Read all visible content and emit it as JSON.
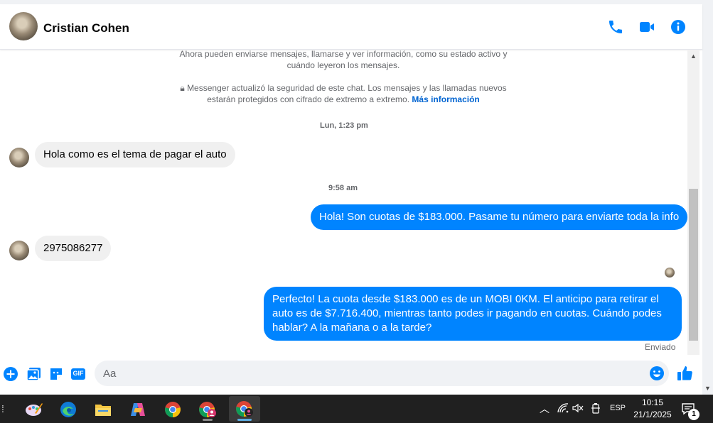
{
  "header": {
    "contact_name": "Cristian Cohen",
    "icons": [
      "phone-icon",
      "video-icon",
      "info-icon"
    ]
  },
  "chat": {
    "system_info_1": "Ahora pueden enviarse mensajes, llamarse y ver información, como su estado activo y cuándo leyeron los mensajes.",
    "system_info_2": "Messenger actualizó la seguridad de este chat. Los mensajes y las llamadas nuevos estarán protegidos con cifrado de extremo a extremo.",
    "system_info_link": "Más información",
    "timestamp_1": "Lun, 1:23 pm",
    "timestamp_2": "9:58 am",
    "messages": [
      {
        "from": "contact",
        "text": "Hola como es el tema de pagar el auto"
      },
      {
        "from": "me",
        "text": "Hola! Son cuotas de $183.000. Pasame tu número para enviarte toda la info"
      },
      {
        "from": "contact",
        "text": "2975086277"
      },
      {
        "from": "me",
        "text": "Perfecto! La cuota desde $183.000 es de un MOBI 0KM. El anticipo para retirar el auto es de $7.716.400, mientras tanto podes ir pagando en cuotas. Cuándo podes hablar? A la mañana o a la tarde?"
      }
    ],
    "status": "Enviado"
  },
  "composer": {
    "placeholder": "Aa",
    "gif_label": "GIF"
  },
  "taskbar": {
    "language": "ESP",
    "time": "10:15",
    "date": "21/1/2025",
    "notification_count": "1"
  },
  "colors": {
    "accent": "#0084ff",
    "incoming_bubble": "#f0f0f0",
    "taskbar": "#202020"
  }
}
